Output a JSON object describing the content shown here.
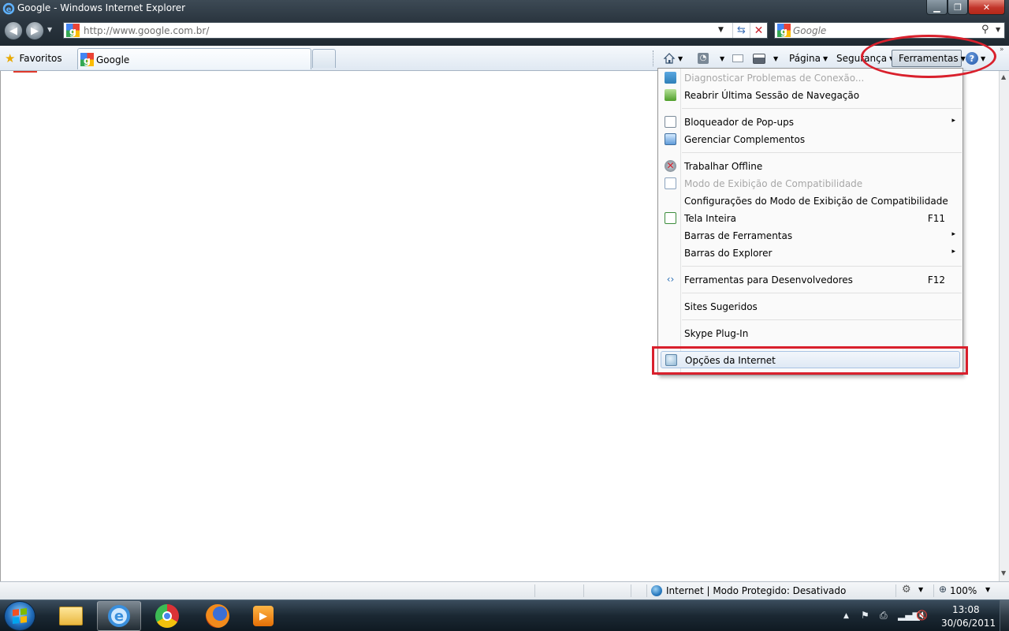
{
  "window": {
    "title": "Google - Windows Internet Explorer",
    "minimize_icon": "minimize-icon",
    "maximize_icon": "restore-icon",
    "close_icon": "close-icon"
  },
  "address_bar": {
    "url": "http://www.google.com.br/",
    "back_icon": "arrow-left-icon",
    "forward_icon": "arrow-right-icon",
    "refresh_icon": "refresh-icon",
    "stop_icon": "stop-x-icon"
  },
  "search": {
    "placeholder": "Google",
    "icon": "magnifier-icon"
  },
  "favorites_bar": {
    "favorites_label": "Favoritos",
    "tab_label": "Google"
  },
  "command_bar": {
    "page_label": "Página",
    "security_label": "Segurança",
    "tools_label": "Ferramentas",
    "help_label": "?"
  },
  "tools_menu": {
    "items": [
      {
        "label": "Diagnosticar Problemas de Conexão...",
        "enabled": false,
        "icon": "network-diagnose-icon"
      },
      {
        "label": "Reabrir Última Sessão de Navegação",
        "enabled": true,
        "icon": "reopen-session-icon"
      },
      {
        "label": "Bloqueador de Pop-ups",
        "enabled": true,
        "icon": "popup-blocker-icon",
        "submenu": true
      },
      {
        "label": "Gerenciar Complementos",
        "enabled": true,
        "icon": "addons-icon"
      },
      {
        "label": "Trabalhar Offline",
        "enabled": true,
        "icon": "work-offline-icon"
      },
      {
        "label": "Modo de Exibição de Compatibilidade",
        "enabled": false,
        "icon": "compat-view-icon"
      },
      {
        "label": "Configurações do Modo de Exibição de Compatibilidade",
        "enabled": true
      },
      {
        "label": "Tela Inteira",
        "enabled": true,
        "icon": "fullscreen-icon",
        "shortcut": "F11"
      },
      {
        "label": "Barras de Ferramentas",
        "enabled": true,
        "submenu": true
      },
      {
        "label": "Barras do Explorer",
        "enabled": true,
        "submenu": true
      },
      {
        "label": "Ferramentas para Desenvolvedores",
        "enabled": true,
        "icon": "dev-tools-icon",
        "shortcut": "F12"
      },
      {
        "label": "Sites Sugeridos",
        "enabled": true
      },
      {
        "label": "Skype Plug-In",
        "enabled": true
      },
      {
        "label": "Opções da Internet",
        "enabled": true,
        "icon": "internet-options-icon",
        "highlighted": true
      }
    ],
    "submenu_arrow": "▸"
  },
  "status_bar": {
    "zone_text": "Internet | Modo Protegido: Desativado",
    "zoom": "100%"
  },
  "taskbar": {
    "apps": [
      "windows-explorer",
      "internet-explorer",
      "google-chrome",
      "firefox",
      "media-player"
    ],
    "clock_time": "13:08",
    "clock_date": "30/06/2011"
  },
  "colors": {
    "annotation_red": "#d9202c",
    "disabled_text": "#a7a7a7",
    "chrome_dark": "#2b3640"
  }
}
